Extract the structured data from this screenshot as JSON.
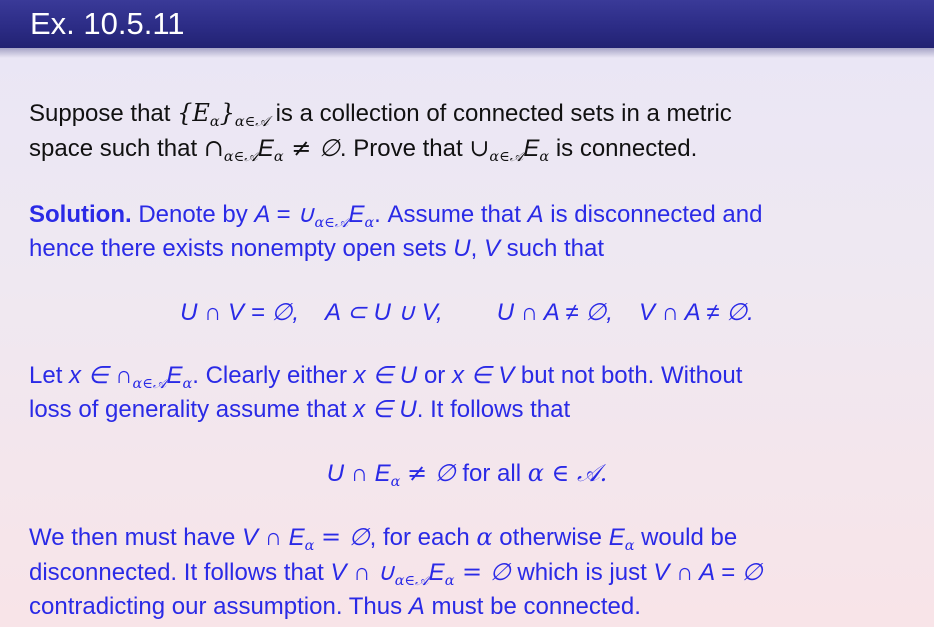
{
  "slide": {
    "title": "Ex. 10.5.11",
    "solution_label": "Solution.",
    "words": {
      "suppose": "Suppose that",
      "collection": "is a collection of connected sets in a metric",
      "space_such": "space such that",
      "prove": ". Prove that",
      "is_connected": "is connected.",
      "denote": "Denote by",
      "assume": ". Assume that",
      "disc_and": "is disconnected and",
      "hence": "hence there exists nonempty open sets",
      "such_that": "such that",
      "let": "Let",
      "clearly": ". Clearly either",
      "or": "or",
      "not_both": "but not both. Without",
      "loss": "loss of generality assume that",
      "follows": ". It follows that",
      "for_all": "for all",
      "we_then": "We then must have",
      "for_each": ", for each",
      "otherwise": "otherwise",
      "would_be": "would be",
      "disconnected": "disconnected. It follows that",
      "which_is": "which is just",
      "contradicting": "contradicting our assumption. Thus",
      "must_be": "must be connected."
    },
    "math": {
      "family": "{E",
      "family_close": "}",
      "index_sub": "α∈𝒜",
      "cap_sym": "∩",
      "cup_sym": "∪",
      "E": "E",
      "alpha": "α",
      "neq_empty": "≠ ∅",
      "A_eq": "A = ∪",
      "A": "A",
      "U": "U",
      "V": "V",
      "x": "x",
      "comma": ",",
      "eq1": "U ∩ V = ∅,",
      "eq2": "A ⊂ U ∪ V,",
      "eq3": "U ∩ A ≠ ∅,",
      "eq4": "V ∩ A ≠ ∅.",
      "x_in_cap": "x ∈ ∩",
      "x_in": "x ∈",
      "U_cap_E": "U ∩ E",
      "alpha_in_A": "α ∈ 𝒜.",
      "V_cap_E": "V ∩ E",
      "eq_empty": "= ∅",
      "V_cap_cup": "V ∩ ∪",
      "V_cap_A": "V ∩ A = ∅"
    },
    "colors": {
      "title_bar": "#2c2c86",
      "text": "#111111",
      "solution": "#2a2ae6"
    }
  }
}
